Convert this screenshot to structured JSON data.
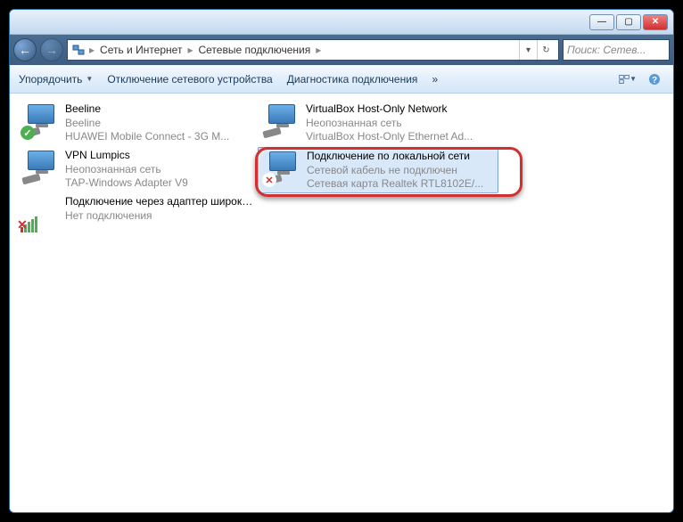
{
  "titlebar": {
    "min": "—",
    "max": "▢",
    "close": "✕"
  },
  "nav": {
    "back": "←",
    "forward": "→"
  },
  "breadcrumb": {
    "icon": "🖧",
    "items": [
      "Сеть и Интернет",
      "Сетевые подключения"
    ],
    "sep": "▸",
    "dropdown": "▾",
    "refresh": "↻"
  },
  "search": {
    "placeholder": "Поиск: Сетев..."
  },
  "toolbar": {
    "organize": "Упорядочить",
    "disable": "Отключение сетевого устройства",
    "diagnose": "Диагностика подключения",
    "more": "»"
  },
  "connections": [
    {
      "name": "Beeline",
      "status": "Beeline",
      "device": "HUAWEI Mobile Connect - 3G M...",
      "icon": "ok"
    },
    {
      "name": "VirtualBox Host-Only Network",
      "status": "Неопознанная сеть",
      "device": "VirtualBox Host-Only Ethernet Ad...",
      "icon": "plain"
    },
    {
      "name": "VPN Lumpics",
      "status": "Неопознанная сеть",
      "device": "TAP-Windows Adapter V9",
      "icon": "plain"
    },
    {
      "name": "Подключение по локальной сети",
      "status": "Сетевой кабель не подключен",
      "device": "Сетевая карта Realtek RTL8102E/...",
      "icon": "x",
      "selected": true
    },
    {
      "name": "Подключение через адаптер широкополосной мобильной с...",
      "status": "Нет подключения",
      "device": "",
      "icon": "signal"
    }
  ]
}
